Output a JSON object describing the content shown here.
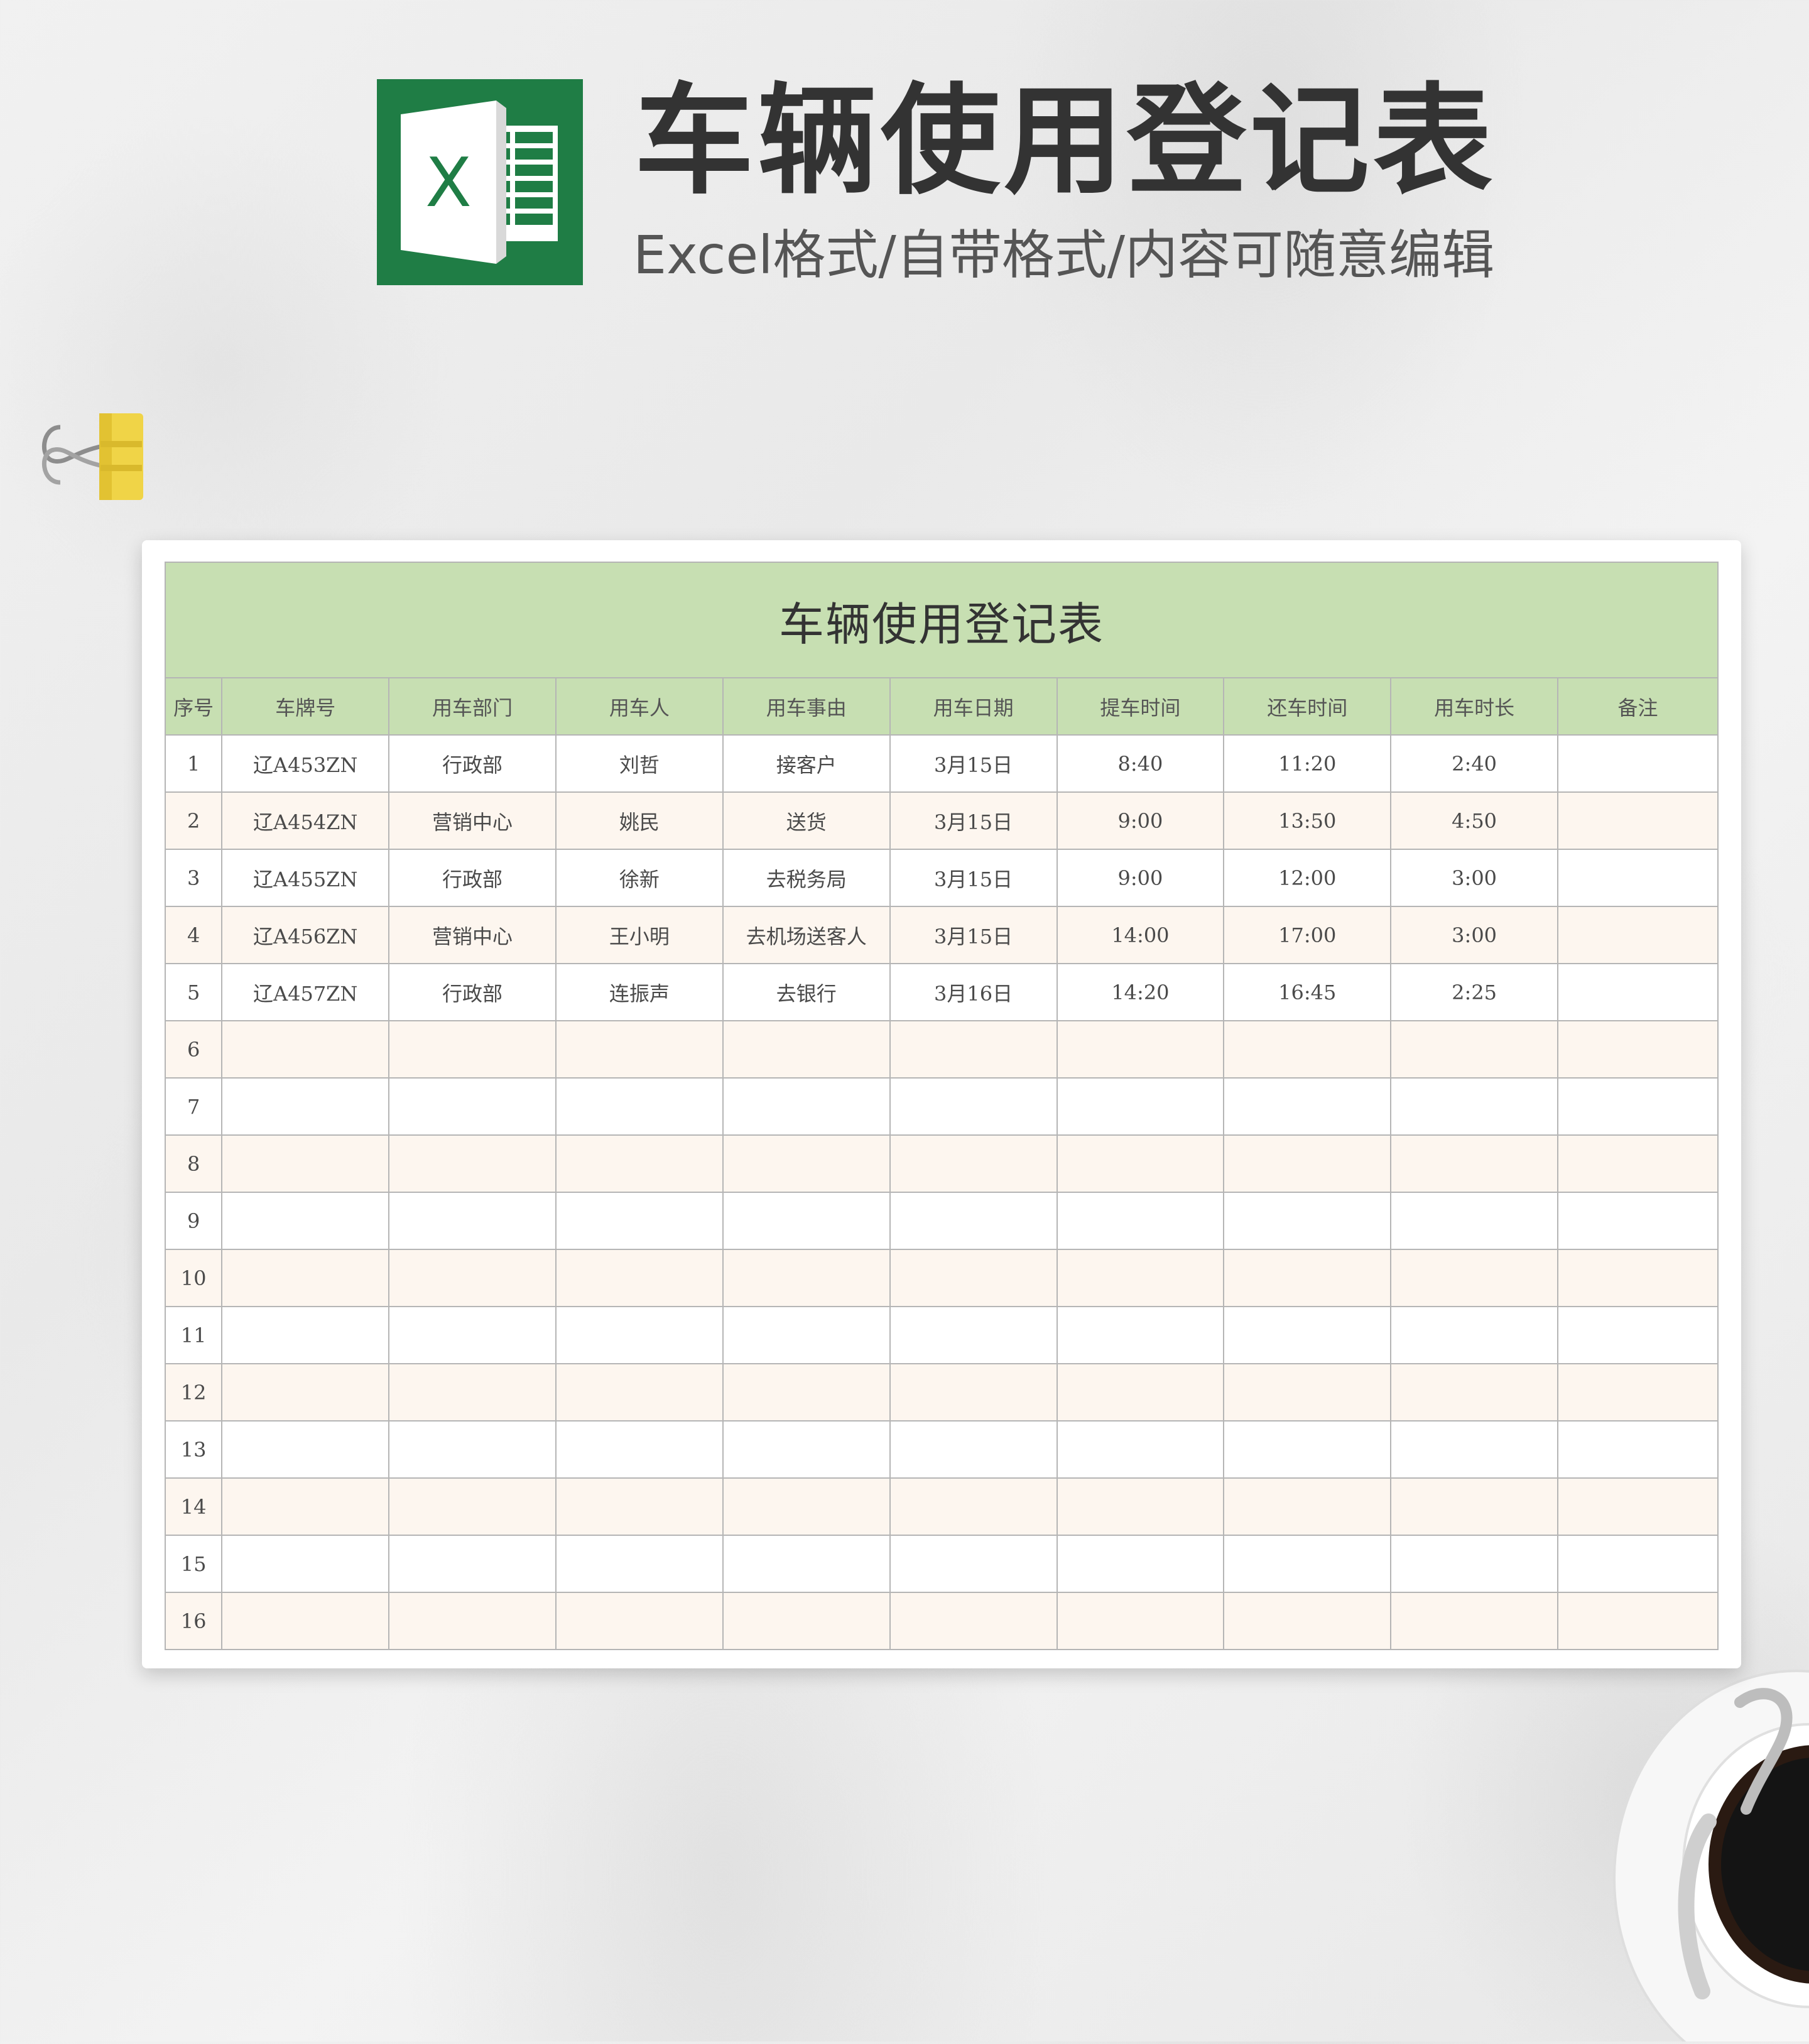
{
  "header": {
    "title": "车辆使用登记表",
    "subtitle": "Excel格式/自带格式/内容可随意编辑",
    "logo_letter": "X",
    "brand_color": "#1f7d45"
  },
  "sheet": {
    "title": "车辆使用登记表",
    "header_color": "#c7dfb2",
    "alt_row_color": "#fdf6ef",
    "columns": [
      "序号",
      "车牌号",
      "用车部门",
      "用车人",
      "用车事由",
      "用车日期",
      "提车时间",
      "还车时间",
      "用车时长",
      "备注"
    ],
    "rows": [
      [
        "1",
        "辽A453ZN",
        "行政部",
        "刘哲",
        "接客户",
        "3月15日",
        "8:40",
        "11:20",
        "2:40",
        ""
      ],
      [
        "2",
        "辽A454ZN",
        "营销中心",
        "姚民",
        "送货",
        "3月15日",
        "9:00",
        "13:50",
        "4:50",
        ""
      ],
      [
        "3",
        "辽A455ZN",
        "行政部",
        "徐新",
        "去税务局",
        "3月15日",
        "9:00",
        "12:00",
        "3:00",
        ""
      ],
      [
        "4",
        "辽A456ZN",
        "营销中心",
        "王小明",
        "去机场送客人",
        "3月15日",
        "14:00",
        "17:00",
        "3:00",
        ""
      ],
      [
        "5",
        "辽A457ZN",
        "行政部",
        "连振声",
        "去银行",
        "3月16日",
        "14:20",
        "16:45",
        "2:25",
        ""
      ],
      [
        "6",
        "",
        "",
        "",
        "",
        "",
        "",
        "",
        "",
        ""
      ],
      [
        "7",
        "",
        "",
        "",
        "",
        "",
        "",
        "",
        "",
        ""
      ],
      [
        "8",
        "",
        "",
        "",
        "",
        "",
        "",
        "",
        "",
        ""
      ],
      [
        "9",
        "",
        "",
        "",
        "",
        "",
        "",
        "",
        "",
        ""
      ],
      [
        "10",
        "",
        "",
        "",
        "",
        "",
        "",
        "",
        "",
        ""
      ],
      [
        "11",
        "",
        "",
        "",
        "",
        "",
        "",
        "",
        "",
        ""
      ],
      [
        "12",
        "",
        "",
        "",
        "",
        "",
        "",
        "",
        "",
        ""
      ],
      [
        "13",
        "",
        "",
        "",
        "",
        "",
        "",
        "",
        "",
        ""
      ],
      [
        "14",
        "",
        "",
        "",
        "",
        "",
        "",
        "",
        "",
        ""
      ],
      [
        "15",
        "",
        "",
        "",
        "",
        "",
        "",
        "",
        "",
        ""
      ],
      [
        "16",
        "",
        "",
        "",
        "",
        "",
        "",
        "",
        "",
        ""
      ]
    ]
  }
}
